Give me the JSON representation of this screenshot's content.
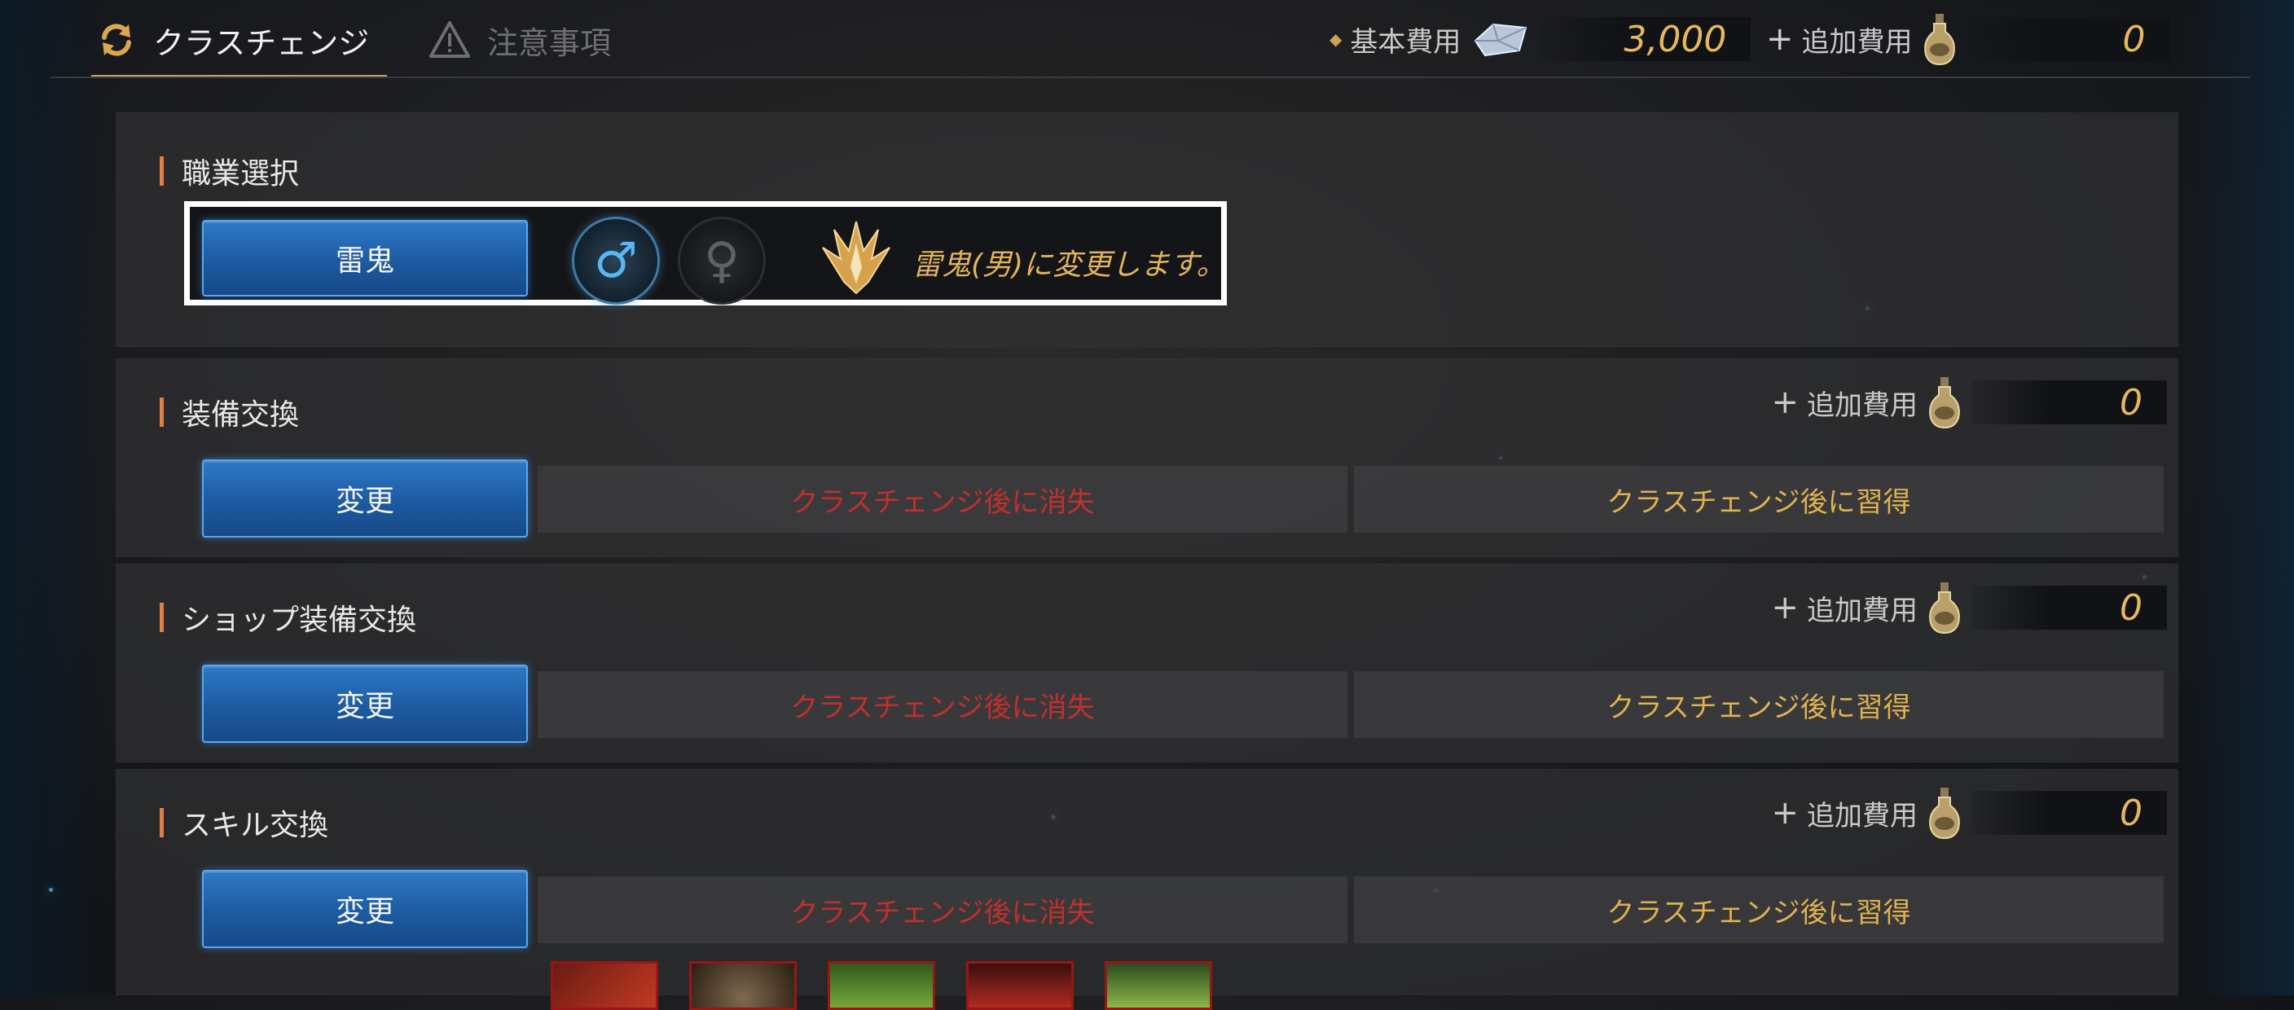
{
  "tabs": [
    {
      "label": "クラスチェンジ",
      "icon": "refresh-icon",
      "active": true
    },
    {
      "label": "注意事項",
      "icon": "warning-icon",
      "active": false
    }
  ],
  "header_costs": {
    "base_label": "基本費用",
    "base_value": "3,000",
    "additional_label": "追加費用",
    "additional_value": "0"
  },
  "job_select": {
    "title": "職業選択",
    "class_button": "雷鬼",
    "male_symbol": "♂",
    "female_symbol": "♀",
    "selected_gender": "male",
    "message": "雷鬼(男)に変更します。"
  },
  "sections": [
    {
      "title": "装備交換",
      "add_label": "追加費用",
      "add_value": "0",
      "button": "変更",
      "lose": "クラスチェンジ後に消失",
      "gain": "クラスチェンジ後に習得"
    },
    {
      "title": "ショップ装備交換",
      "add_label": "追加費用",
      "add_value": "0",
      "button": "変更",
      "lose": "クラスチェンジ後に消失",
      "gain": "クラスチェンジ後に習得"
    },
    {
      "title": "スキル交換",
      "add_label": "追加費用",
      "add_value": "0",
      "button": "変更",
      "lose": "クラスチェンジ後に消失",
      "gain": "クラスチェンジ後に習得"
    }
  ],
  "colors": {
    "accent_gold": "#e2b35a",
    "lose_red": "#c2302c",
    "button_blue": "#2f79c5"
  }
}
